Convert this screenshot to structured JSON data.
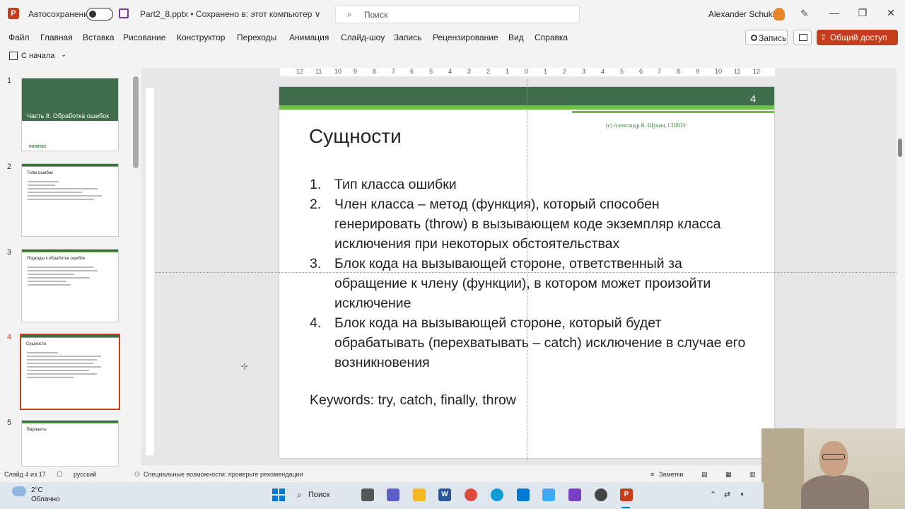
{
  "titlebar": {
    "app_icon_letter": "P",
    "autosave_label": "Автосохранение",
    "document_title": "Part2_8.pptx • Сохранено в: этот компьютер ∨",
    "search_placeholder": "Поиск",
    "user_name": "Alexander Schukin",
    "minimize": "—",
    "restore": "❐",
    "close": "✕"
  },
  "menu": {
    "items": [
      "Файл",
      "Главная",
      "Вставка",
      "Рисование",
      "Конструктор",
      "Переходы",
      "Анимация",
      "Слайд-шоу",
      "Запись",
      "Рецензирование",
      "Вид",
      "Справка"
    ],
    "record_label": "Запись",
    "share_label": "Общий доступ"
  },
  "quick_toolbar": {
    "from_start_label": "С начала",
    "dropdown": "⌄"
  },
  "thumbnails": [
    {
      "num": "1",
      "title": "Часть 8. Обработка ошибок",
      "logo": "ПОЛИТЕХ"
    },
    {
      "num": "2",
      "title": "Типы ошибок"
    },
    {
      "num": "3",
      "title": "Подходы к обработке ошибок"
    },
    {
      "num": "4",
      "title": "Сущности"
    },
    {
      "num": "5",
      "title": "Варианты"
    }
  ],
  "ruler": {
    "marks": [
      "12",
      "11",
      "10",
      "9",
      "8",
      "7",
      "6",
      "5",
      "4",
      "3",
      "2",
      "1",
      "0",
      "1",
      "2",
      "3",
      "4",
      "5",
      "6",
      "7",
      "8",
      "9",
      "10",
      "11",
      "12"
    ]
  },
  "slide": {
    "number": "4",
    "copyright": "(c) Александр В. Щукин, СПбПУ",
    "title": "Сущности",
    "items": [
      {
        "n": "1.",
        "text": "Тип класса ошибки"
      },
      {
        "n": "2.",
        "text": "Член класса – метод (функция), который способен генерировать (throw) в вызывающем коде экземпляр класса исключения при некоторых обстоятельствах"
      },
      {
        "n": "3.",
        "text": "Блок кода на вызывающей стороне, ответственный за обращение к члену (функции), в котором может произойти исключение"
      },
      {
        "n": "4.",
        "text": "Блок кода на вызывающей стороне, который будет обрабатывать (перехватывать – catch) исключение в случае его возникновения"
      }
    ],
    "keywords": "Keywords: try, catch, finally, throw"
  },
  "status": {
    "slide_of": "Слайд 4 из 17",
    "language": "русский",
    "accessibility": "Специальные возможности: проверьте рекомендации",
    "notes": "Заметки"
  },
  "taskbar": {
    "temperature": "2°C",
    "condition": "Облачно",
    "search_label": "Поиск"
  },
  "colors": {
    "accent": "#c43e1c",
    "slide_header": "#3f6c4a",
    "slide_green": "#6cc04a"
  }
}
